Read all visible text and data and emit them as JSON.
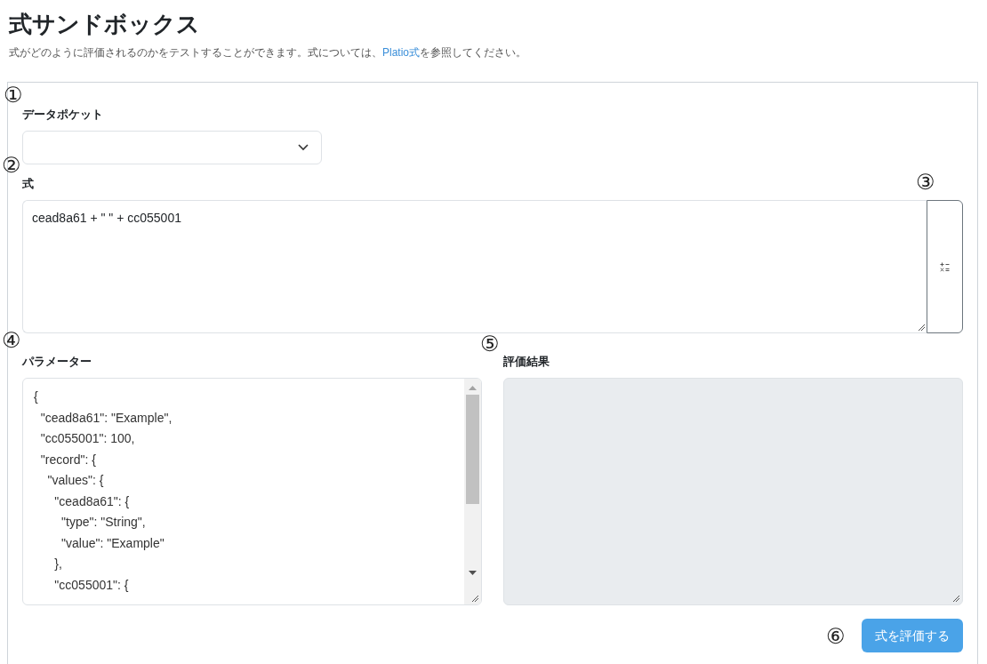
{
  "header": {
    "title": "式サンドボックス",
    "description_before": "式がどのように評価されるのかをテストすることができます。式については、",
    "description_link": "Platio式",
    "description_after": "を参照してください。"
  },
  "data_pocket": {
    "label": "データポケット"
  },
  "expression": {
    "label": "式",
    "value": "cead8a61 + \" \" + cc055001"
  },
  "parameters": {
    "label": "パラメーター",
    "lines": [
      "{",
      "  \"cead8a61\": \"Example\",",
      "  \"cc055001\": 100,",
      "  \"record\": {",
      "    \"values\": {",
      "      \"cead8a61\": {",
      "        \"type\": \"String\",",
      "        \"value\": \"Example\"",
      "      },",
      "      \"cc055001\": {"
    ]
  },
  "result": {
    "label": "評価結果"
  },
  "evaluate_button": {
    "label": "式を評価する"
  },
  "annotations": [
    "①",
    "②",
    "③",
    "④",
    "⑤",
    "⑥"
  ]
}
